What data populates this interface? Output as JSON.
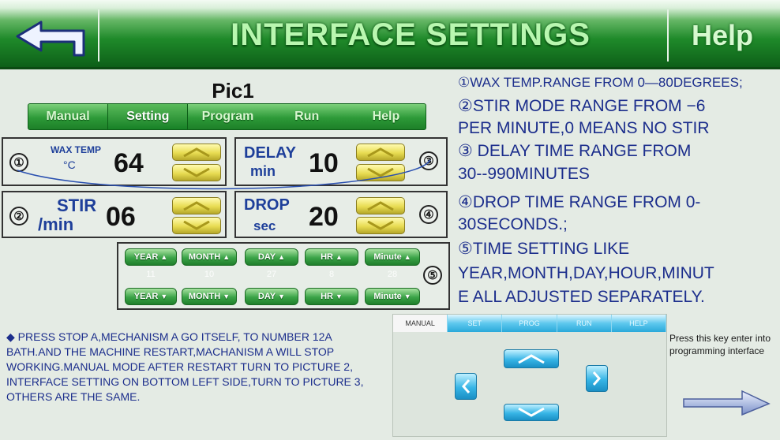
{
  "header": {
    "title": "INTERFACE SETTINGS",
    "back_icon": "back-arrow-icon",
    "help_label": "Help"
  },
  "left": {
    "pic_label": "Pic1",
    "tabs": [
      {
        "label": "Manual",
        "active": false
      },
      {
        "label": "Setting",
        "active": true
      },
      {
        "label": "Program",
        "active": false
      },
      {
        "label": "Run",
        "active": false
      },
      {
        "label": "Help",
        "active": false
      }
    ],
    "params": {
      "wax": {
        "num": "①",
        "label": "WAX TEMP",
        "unit": "°C",
        "value": "64"
      },
      "delay": {
        "num": "③",
        "label": "DELAY",
        "unit": "min",
        "value": "10"
      },
      "stir": {
        "num": "②",
        "label": "STIR",
        "unit": "/min",
        "value": "06"
      },
      "drop": {
        "num": "④",
        "label": "DROP",
        "unit": "sec",
        "value": "20"
      }
    },
    "time": {
      "num": "⑤",
      "fields": [
        {
          "label": "YEAR",
          "value": "11"
        },
        {
          "label": "MONTH",
          "value": "10"
        },
        {
          "label": "DAY",
          "value": "27"
        },
        {
          "label": "HR",
          "value": "8"
        },
        {
          "label": "Minute",
          "value": "28"
        }
      ]
    }
  },
  "info": {
    "lines": [
      "①WAX TEMP.RANGE FROM 0—80DEGREES;",
      "②STIR MODE RANGE FROM  −6",
      "PER MINUTE,0 MEANS NO STIR",
      "③ DELAY TIME RANGE FROM",
      "30--990MINUTES",
      "④DROP TIME RANGE FROM 0-",
      "30SECONDS.;",
      "⑤TIME SETTING LIKE",
      "YEAR,MONTH,DAY,HOUR,MINUT",
      "E ALL ADJUSTED SEPARATELY."
    ]
  },
  "bottom": {
    "note": "◆ PRESS STOP A,MECHANISM A GO ITSELF, TO NUMBER 12A BATH.AND THE MACHINE RESTART,MACHANISM A WILL STOP WORKING.MANUAL MODE AFTER RESTART TURN TO PICTURE 2,  INTERFACE SETTING ON BOTTOM LEFT SIDE,TURN TO PICTURE 3,  OTHERS ARE THE SAME.",
    "mini_tabs": [
      "MANUAL",
      "SET",
      "PROG",
      "RUN",
      "HELP"
    ],
    "hint": "Press this key enter into programming interface",
    "hint_arrow_icon": "right-arrow-icon"
  },
  "colors": {
    "header_green": "#1f8a2a",
    "info_blue": "#1c2e8c",
    "button_yellow": "#e8dc52",
    "button_cyan": "#37b5e6"
  }
}
